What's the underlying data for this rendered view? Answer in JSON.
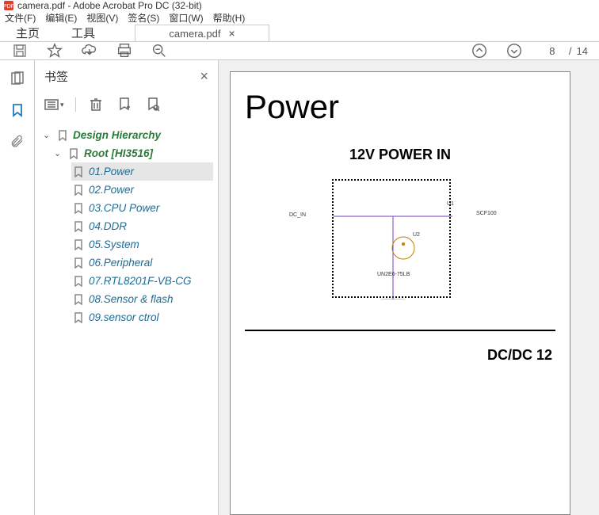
{
  "title": "camera.pdf - Adobe Acrobat Pro DC (32-bit)",
  "menu": {
    "file": "文件(F)",
    "edit": "编辑(E)",
    "view": "视图(V)",
    "sign": "签名(S)",
    "window": "窗口(W)",
    "help": "帮助(H)"
  },
  "tabs": {
    "home": "主页",
    "tools": "工具",
    "doc": "camera.pdf"
  },
  "pagenav": {
    "current": "8",
    "sep": "/",
    "total": "14"
  },
  "sidepanel": {
    "title": "书签"
  },
  "bookmarks": {
    "root_a": "Design Hierarchy",
    "root_b": "Root [HI3516]",
    "items": [
      "01.Power",
      "02.Power",
      "03.CPU Power",
      "04.DDR",
      "05.System",
      "06.Peripheral",
      "07.RTL8201F-VB-CG",
      "08.Sensor  & flash",
      "09.sensor ctrol"
    ]
  },
  "doc": {
    "h1": "Power",
    "h2": "12V POWER IN",
    "h3": "DC/DC 12",
    "labels": {
      "dcin": "DC_IN",
      "u1": "U1",
      "scf": "SCF100",
      "u2": "U2",
      "cap": "UN2E6-75LB"
    }
  }
}
